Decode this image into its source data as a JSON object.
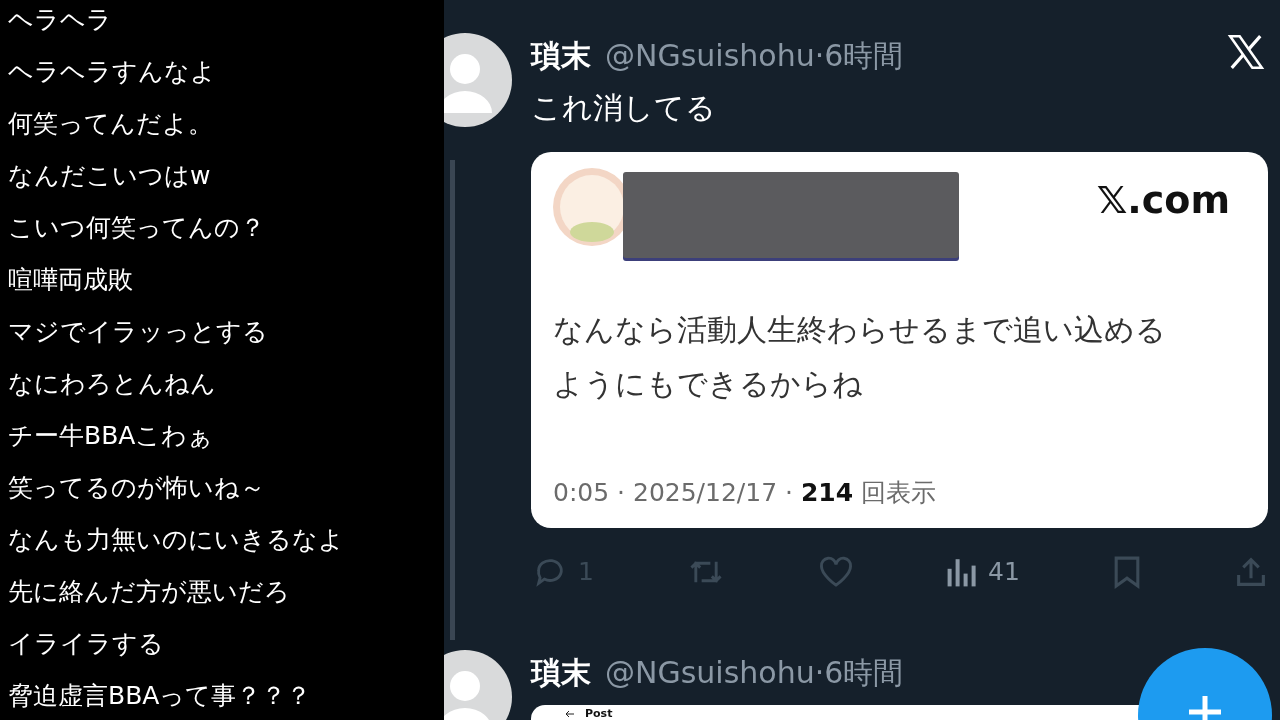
{
  "comments": [
    "ヘラヘラ",
    "ヘラヘラすんなよ",
    "何笑ってんだよ。",
    "なんだこいつはw",
    "こいつ何笑ってんの？",
    "喧嘩両成敗",
    "マジでイラッっとする",
    "なにわろとんねん",
    "チー牛BBAこわぁ",
    "笑ってるのが怖いね～",
    "なんも力無いのにいきるなよ",
    "先に絡んだ方が悪いだろ",
    "イライラする",
    "脅迫虚言BBAって事？？？"
  ],
  "tweets": [
    {
      "name": "瑣末",
      "meta": "@NGsuishohu·6時間",
      "body": "これ消してる",
      "card": {
        "domain": "𝕏.com",
        "lines": [
          "なんなら活動人生終わらせるまで追い込める",
          "ようにもできるからね"
        ],
        "footer": "0:05 · 2025/12/17 · **214** 回表示"
      },
      "actions": [
        {
          "kind": "reply",
          "count": "1"
        },
        {
          "kind": "repost"
        },
        {
          "kind": "like"
        },
        {
          "kind": "views",
          "count": "41"
        },
        {
          "kind": "bookmark"
        },
        {
          "kind": "share"
        }
      ]
    },
    {
      "name": "瑣末",
      "meta": "@NGsuishohu·6時間",
      "card_header": "Post"
    }
  ]
}
